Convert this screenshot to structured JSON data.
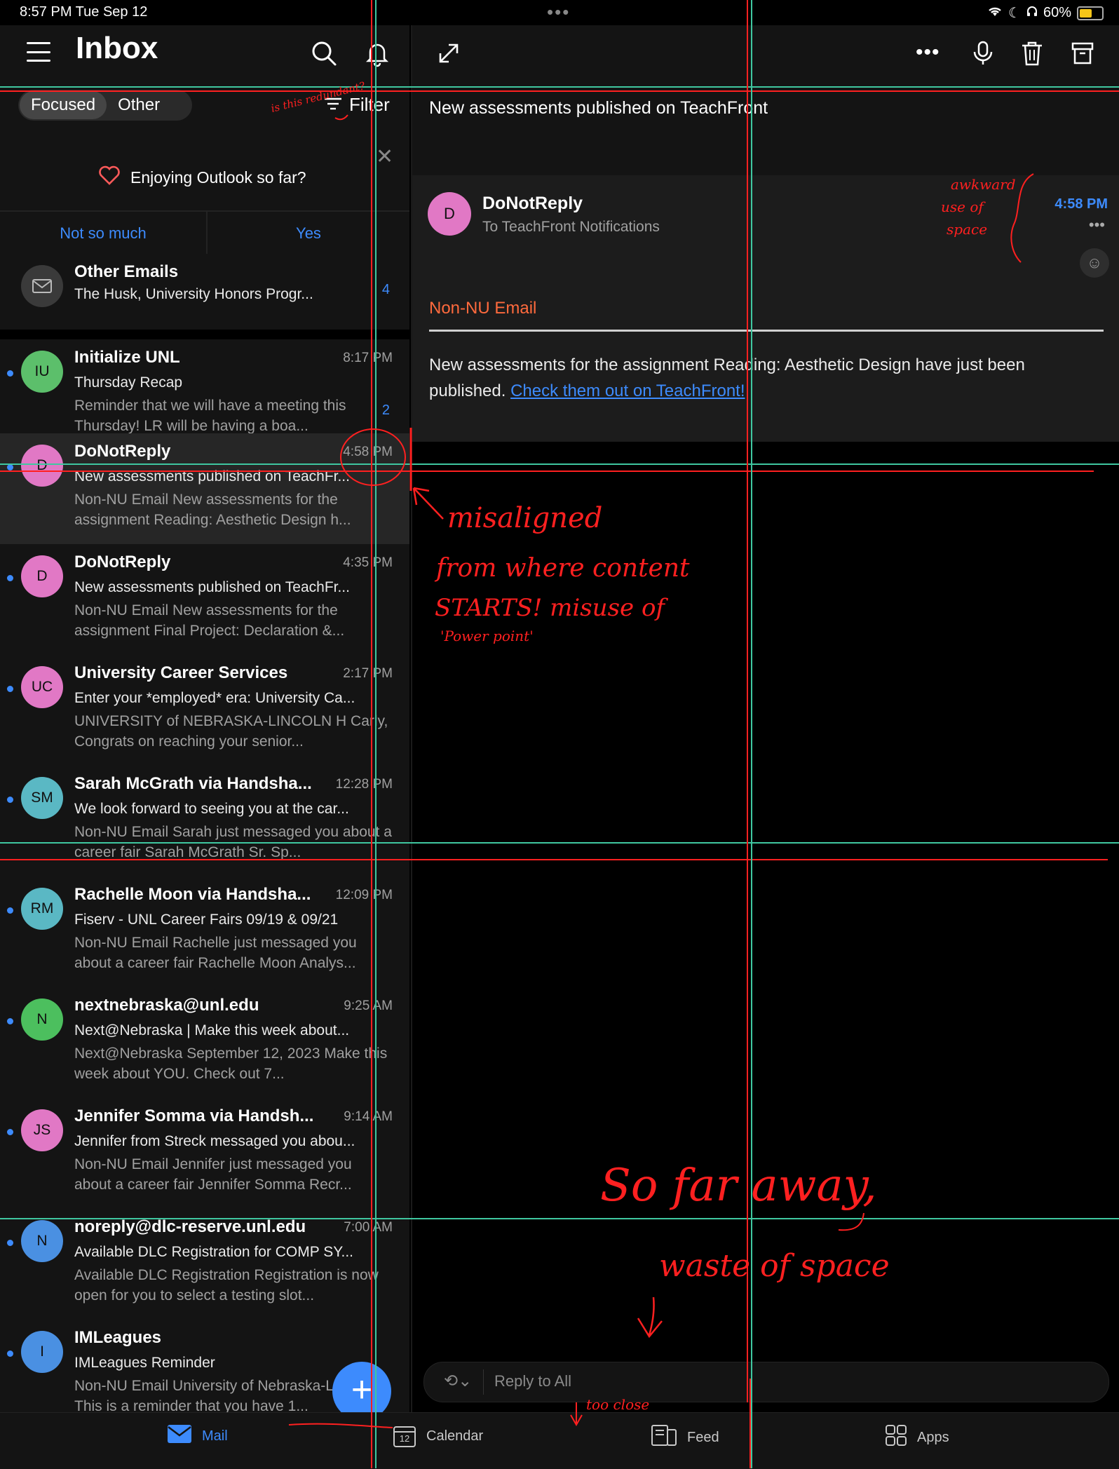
{
  "status_bar": {
    "time": "8:57 PM   Tue Sep 12",
    "battery": "60%",
    "battery_level": 0.6
  },
  "inbox": {
    "title": "Inbox",
    "tabs": [
      {
        "label": "Focused",
        "active": true
      },
      {
        "label": "Other",
        "active": false
      }
    ],
    "filter_label": "Filter"
  },
  "promo": {
    "question": "Enjoying Outlook so far?",
    "no_label": "Not so much",
    "yes_label": "Yes"
  },
  "mail_list": [
    {
      "sender": "Other Emails",
      "subject": "The Husk, University Honors Progr...",
      "preview": "",
      "time": "",
      "count": "4",
      "initials": "",
      "avatar_color": "#3a3a3a",
      "unread": false
    },
    {
      "sender": "Initialize UNL",
      "subject": "Thursday Recap",
      "preview": "Reminder that we will have a meeting this Thursday! LR will be having a boa...",
      "time": "8:17 PM",
      "count": "2",
      "initials": "IU",
      "avatar_color": "#5cbf6b",
      "unread": true
    },
    {
      "sender": "DoNotReply",
      "subject": "New assessments published on TeachFr...",
      "preview": "Non-NU Email New assessments for the assignment Reading: Aesthetic Design h...",
      "time": "4:58 PM",
      "count": "",
      "initials": "D",
      "avatar_color": "#e178c5",
      "unread": true,
      "selected": true
    },
    {
      "sender": "DoNotReply",
      "subject": "New assessments published on TeachFr...",
      "preview": "Non-NU Email New assessments for the assignment Final Project: Declaration &...",
      "time": "4:35 PM",
      "count": "",
      "initials": "D",
      "avatar_color": "#e178c5",
      "unread": true
    },
    {
      "sender": "University Career Services",
      "subject": "Enter your *employed* era: University Ca...",
      "preview": "UNIVERSITY of NEBRASKA-LINCOLN H Carly, Congrats on reaching your senior...",
      "time": "2:17 PM",
      "count": "",
      "initials": "UC",
      "avatar_color": "#e178c5",
      "unread": true
    },
    {
      "sender": "Sarah McGrath via Handsha...",
      "subject": "We look forward to seeing you at the car...",
      "preview": "Non-NU Email Sarah just messaged you about a career fair Sarah McGrath Sr. Sp...",
      "time": "12:28 PM",
      "count": "",
      "initials": "SM",
      "avatar_color": "#5ab8c4",
      "unread": true
    },
    {
      "sender": "Rachelle Moon via Handsha...",
      "subject": "Fiserv - UNL Career Fairs 09/19 & 09/21",
      "preview": "Non-NU Email Rachelle just messaged you about a career fair Rachelle Moon Analys...",
      "time": "12:09 PM",
      "count": "",
      "initials": "RM",
      "avatar_color": "#5ab8c4",
      "unread": true
    },
    {
      "sender": "nextnebraska@unl.edu",
      "subject": "Next@Nebraska | Make this week about...",
      "preview": "Next@Nebraska September 12, 2023 Make this week about YOU. Check out 7...",
      "time": "9:25 AM",
      "count": "",
      "initials": "N",
      "avatar_color": "#4cbf5e",
      "unread": true
    },
    {
      "sender": "Jennifer Somma via Handsh...",
      "subject": "Jennifer from Streck messaged you abou...",
      "preview": "Non-NU Email Jennifer just messaged you about a career fair Jennifer Somma Recr...",
      "time": "9:14 AM",
      "count": "",
      "initials": "JS",
      "avatar_color": "#e178c5",
      "unread": true
    },
    {
      "sender": "noreply@dlc-reserve.unl.edu",
      "subject": "Available DLC Registration for COMP SY...",
      "preview": "Available DLC Registration Registration is now open for you to select a testing slot...",
      "time": "7:00 AM",
      "count": "",
      "initials": "N",
      "avatar_color": "#4a90e2",
      "unread": true
    },
    {
      "sender": "IMLeagues",
      "subject": "IMLeagues Reminder",
      "preview": "Non-NU Email University of Nebraska-Lincoln This is a reminder that you have 1...",
      "time": "",
      "count": "",
      "initials": "I",
      "avatar_color": "#4a90e2",
      "unread": true
    }
  ],
  "reader": {
    "subject": "New assessments published on TeachFront",
    "sender": "DoNotReply",
    "initials": "D",
    "to": "To TeachFront Notifications",
    "time": "4:58 PM",
    "banner": "Non-NU Email",
    "body": "New assessments for the assignment Reading: Aesthetic Design have just been published.",
    "link": "Check them out on TeachFront!",
    "reply_placeholder": "Reply to All"
  },
  "tab_bar": {
    "items": [
      {
        "label": "Mail",
        "active": true
      },
      {
        "label": "Calendar",
        "active": false,
        "badge": "12"
      },
      {
        "label": "Feed",
        "active": false
      },
      {
        "label": "Apps",
        "active": false
      }
    ]
  },
  "annotations": {
    "redundant": "is this redundant?",
    "misaligned": [
      "misaligned",
      "from where content",
      "STARTS! misuse of",
      "'Power point'"
    ],
    "awkward": [
      "awkward",
      "use of",
      "space"
    ],
    "far_away": "So far away,",
    "waste": "waste of space",
    "too_close": "too close"
  },
  "colors": {
    "accent": "#3d8bfd",
    "annotation": "#ff2020",
    "guide": "#3fc7a0",
    "banner": "#ff6a3d"
  }
}
